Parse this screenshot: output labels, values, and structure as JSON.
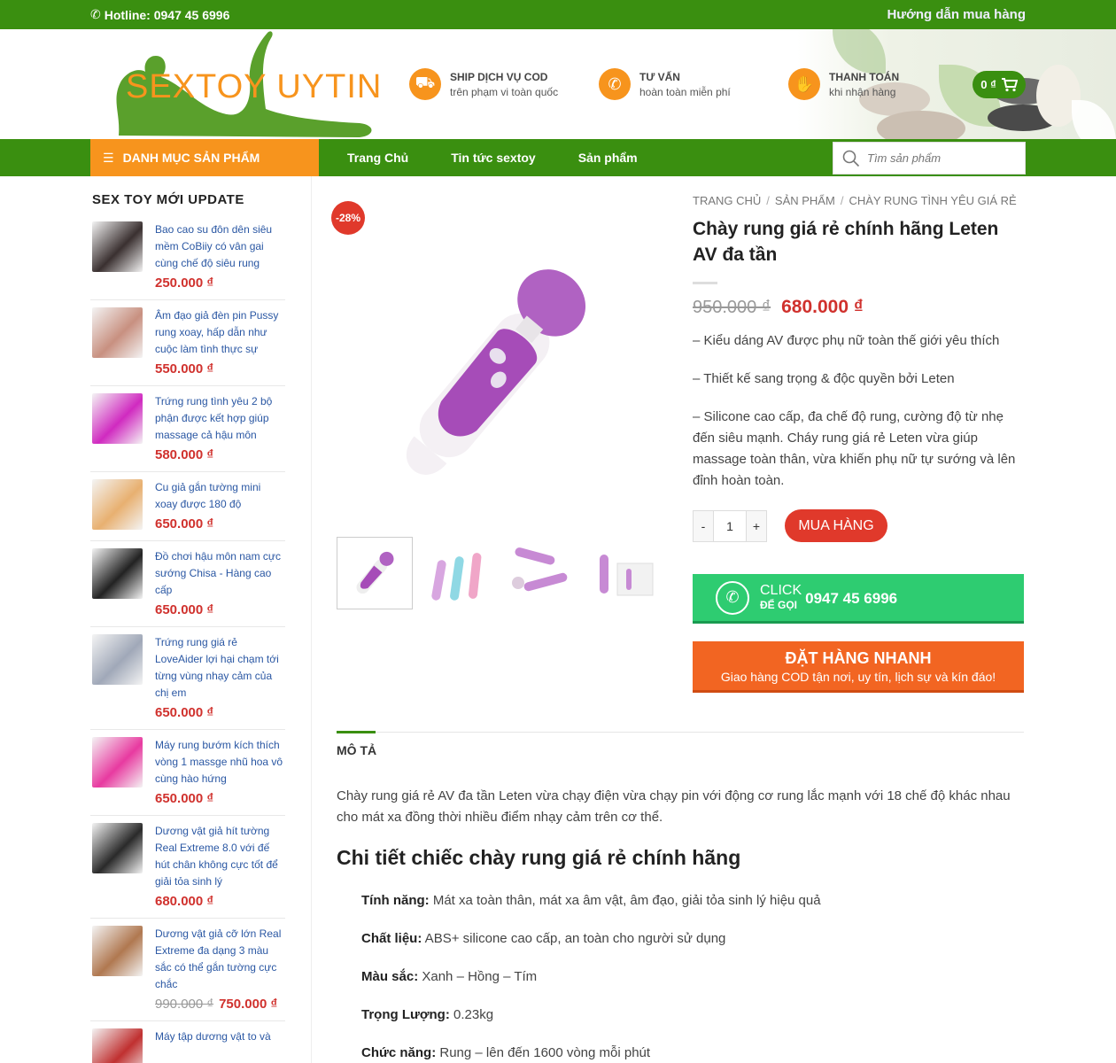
{
  "topbar": {
    "hotline": "Hotline: 0947 45 6996",
    "guide": "Hướng dẫn mua hàng"
  },
  "logo": {
    "text": "SEXTOY UYTIN"
  },
  "features": [
    {
      "icon": "truck-icon",
      "title": "SHIP DỊCH VỤ COD",
      "sub": "trên phạm vi toàn quốc"
    },
    {
      "icon": "phone-icon",
      "title": "TƯ VẤN",
      "sub": "hoàn toàn miễn phí"
    },
    {
      "icon": "hand-money-icon",
      "title": "THANH TOÁN",
      "sub": "khi nhận hàng"
    }
  ],
  "cart": {
    "label": "0 ₫"
  },
  "nav": {
    "category_button": "DANH MỤC SẢN PHẨM",
    "items": [
      "Trang Chủ",
      "Tin tức sextoy",
      "Sản phẩm"
    ],
    "search_placeholder": "Tìm sản phẩm"
  },
  "sidebar": {
    "title": "SEX TOY MỚI UPDATE",
    "items": [
      {
        "title": "Bao cao su đôn dên siêu mềm CoBiiy có vân gai cùng chế độ siêu rung",
        "price": "250.000 ₫",
        "old": "",
        "color": "#3a3030"
      },
      {
        "title": "Âm đạo giả đèn pin Pussy rung xoay, hấp dẫn như cuộc làm tình thực sự",
        "price": "550.000 ₫",
        "old": "",
        "color": "#c89080"
      },
      {
        "title": "Trứng rung tình yêu 2 bộ phận được kết hợp giúp massage cả hậu môn",
        "price": "580.000 ₫",
        "old": "",
        "color": "#d02ac0"
      },
      {
        "title": "Cu giả gắn tường mini xoay được 180 độ",
        "price": "650.000 ₫",
        "old": "",
        "color": "#e8b070"
      },
      {
        "title": "Đồ chơi hậu môn nam cực sướng Chisa - Hàng cao cấp",
        "price": "650.000 ₫",
        "old": "",
        "color": "#222222"
      },
      {
        "title": "Trứng rung giá rẻ LoveAider lợi hại chạm tới từng vùng nhạy cảm của chị em",
        "price": "650.000 ₫",
        "old": "",
        "color": "#a0a8b8"
      },
      {
        "title": "Máy rung bướm kích thích vòng 1 massge nhũ hoa vô cùng hào hứng",
        "price": "650.000 ₫",
        "old": "",
        "color": "#e83aa0"
      },
      {
        "title": "Dương vật giả hít tường Real Extreme 8.0 với đế hút chân không cực tốt để giải tỏa sinh lý",
        "price": "680.000 ₫",
        "old": "",
        "color": "#2a2a2a"
      },
      {
        "title": "Dương vật giả cỡ lớn Real Extreme đa dạng 3 màu sắc có thể gắn tường cực chắc",
        "price": "750.000 ₫",
        "old": "990.000 ₫",
        "color": "#b07850"
      },
      {
        "title": "Máy tập dương vật to và",
        "price": "",
        "old": "",
        "color": "#c03030"
      }
    ]
  },
  "product": {
    "badge": "-28%",
    "breadcrumb": [
      "TRANG CHỦ",
      "SẢN PHẨM",
      "CHÀY RUNG TÌNH YÊU GIÁ RẺ"
    ],
    "title": "Chày rung giá rẻ chính hãng Leten AV đa tần",
    "old_price": "950.000 ₫",
    "price": "680.000 ₫",
    "desc": [
      "– Kiểu dáng AV được phụ nữ toàn thế giới yêu thích",
      "– Thiết kế sang trọng & độc quyền bởi Leten",
      "– Silicone cao cấp, đa chế độ rung, cường độ từ nhẹ đến siêu mạnh. Cháy rung giá rẻ Leten vừa giúp massage toàn thân, vừa khiến phụ nữ tự sướng và lên đỉnh hoàn toàn."
    ],
    "qty": "1",
    "qty_minus": "-",
    "qty_plus": "+",
    "buy_label": "MUA HÀNG",
    "call": {
      "click": "CLICK",
      "sub": "ĐỂ GỌI",
      "phone": "0947 45 6996"
    },
    "order": {
      "title": "ĐẶT HÀNG NHANH",
      "sub": "Giao hàng COD tận nơi, uy tín, lịch sự và kín đáo!"
    },
    "tab_label": "MÔ TẢ",
    "body": "Chày rung giá rẻ AV đa tần Leten vừa chạy điện vừa chạy pin với động cơ rung lắc mạnh với 18 chế độ khác nhau cho mát xa đồng thời nhiều điểm nhạy cảm trên cơ thể.",
    "heading": "Chi tiết chiếc chày rung giá rẻ chính hãng",
    "specs": [
      {
        "k": "Tính năng:",
        "v": " Mát xa toàn thân, mát xa âm vật, âm đạo, giải tỏa sinh lý hiệu quả"
      },
      {
        "k": "Chất liệu:",
        "v": " ABS+ silicone cao cấp, an toàn cho người sử dụng"
      },
      {
        "k": "Màu sắc:",
        "v": " Xanh – Hồng – Tím"
      },
      {
        "k": "Trọng Lượng:",
        "v": " 0.23kg"
      },
      {
        "k": "Chức năng:",
        "v": " Rung – lên đến 1600 vòng mỗi phút"
      }
    ]
  },
  "colors": {
    "green": "#3a8f10",
    "orange": "#f7941d",
    "red": "#d0312d",
    "call_green": "#2ecc71",
    "order_orange": "#f26522",
    "product_purple": "#a64cb8"
  }
}
